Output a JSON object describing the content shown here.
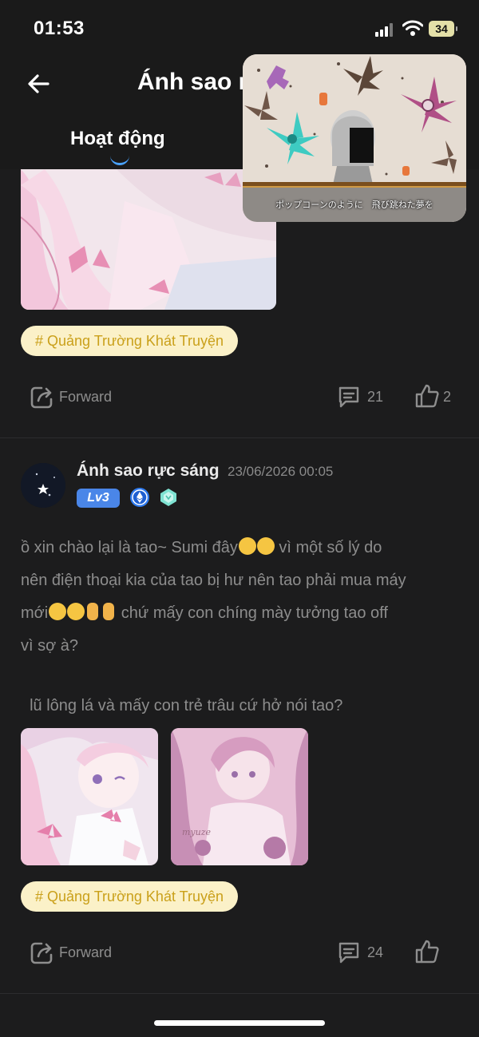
{
  "status_bar": {
    "time": "01:53",
    "battery": "34"
  },
  "header": {
    "title": "Ánh sao rực sáng",
    "back_icon": "arrow-left-icon"
  },
  "tabs": [
    {
      "label": "Hoạt động",
      "active": true
    }
  ],
  "pip_video": {
    "caption": "ポップコーンのように　飛び跳ねた夢を"
  },
  "colors": {
    "background": "#1c1c1d",
    "tag_bg": "#fbf1c8",
    "tag_text": "#caa01a",
    "muted": "#8e8e8e",
    "accent": "#4aa3ff"
  },
  "posts": [
    {
      "tag": "# Quảng Trường Khát Truyện",
      "actions": {
        "forward": "Forward",
        "comments": "21",
        "likes": "2"
      }
    },
    {
      "author": "Ánh sao rực sáng",
      "date": "23/06/2026 00:05",
      "level": "Lv3",
      "text_line1_a": "ồ xin chào lại là tao~ Sumi đây",
      "text_line1_b": " vì một số lý do",
      "text_line2": "nên điện thoại kia của tao bị hư nên tao phải mua máy",
      "text_line3_a": "mới",
      "text_line3_b": " chứ mấy con chíng mày tưởng tao off",
      "text_line4": "vì sợ à?",
      "text_line5": "  lũ lông lá và mấy con trẻ trâu cứ hở nói tao?",
      "tag": "# Quảng Trường Khát Truyện",
      "actions": {
        "forward": "Forward",
        "comments": "24",
        "likes": ""
      }
    }
  ]
}
